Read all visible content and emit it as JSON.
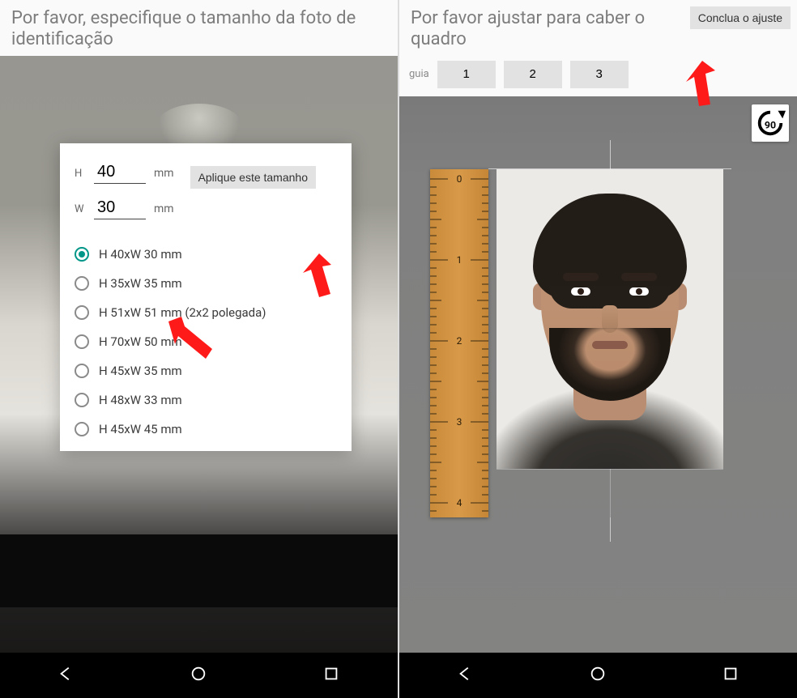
{
  "left": {
    "title": "Por favor, especifique o tamanho da foto de identificação",
    "modal": {
      "h_label": "H",
      "h_value": "40",
      "w_label": "W",
      "w_value": "30",
      "unit": "mm",
      "apply_label": "Aplique este tamanho"
    },
    "options": [
      {
        "label": "H 40xW 30 mm",
        "selected": true
      },
      {
        "label": "H 35xW 35 mm",
        "selected": false
      },
      {
        "label": "H 51xW 51 mm (2x2 polegada)",
        "selected": false
      },
      {
        "label": "H 70xW 50 mm",
        "selected": false
      },
      {
        "label": "H 45xW 35 mm",
        "selected": false
      },
      {
        "label": "H 48xW 33 mm",
        "selected": false
      },
      {
        "label": "H 45xW 45 mm",
        "selected": false
      }
    ]
  },
  "right": {
    "title": "Por favor ajustar para caber o quadro",
    "finish_label": "Conclua o ajuste",
    "guides_label": "guia",
    "guides": [
      "1",
      "2",
      "3"
    ],
    "rotate_label": "90",
    "ruler_marks": [
      "0",
      "1",
      "2",
      "3",
      "4"
    ]
  },
  "nav": {
    "back": "back",
    "home": "home",
    "recent": "recent"
  }
}
